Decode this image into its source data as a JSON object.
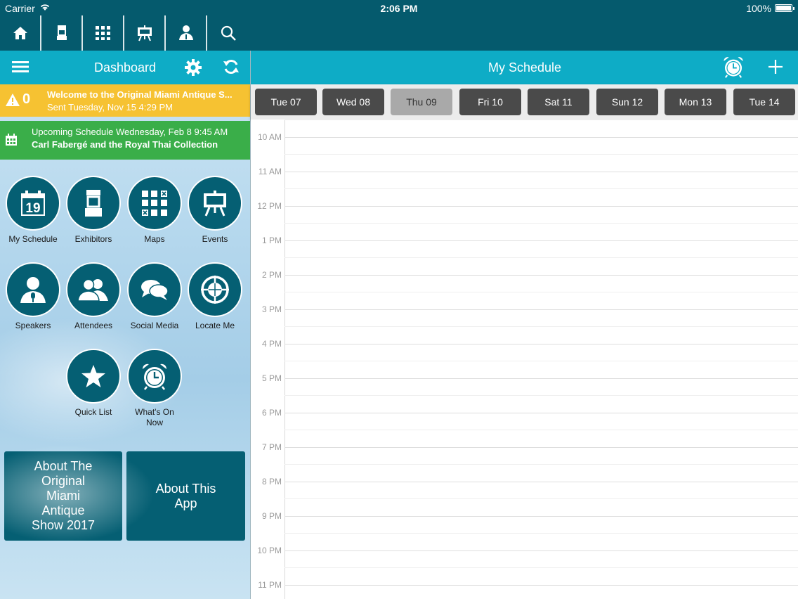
{
  "status": {
    "carrier": "Carrier",
    "time": "2:06 PM",
    "battery": "100%"
  },
  "topnav": {
    "icons": [
      "home-icon",
      "exhibitor-booth-icon",
      "maps-grid-icon",
      "easel-icon",
      "speaker-icon",
      "search-icon"
    ]
  },
  "dashboard": {
    "title": "Dashboard"
  },
  "alert": {
    "count": "0",
    "title": "Welcome to the Original Miami Antique S...",
    "sent": "Sent Tuesday, Nov 15 4:29 PM"
  },
  "upcoming": {
    "line1": "Upcoming Schedule Wednesday, Feb 8 9:45 AM",
    "line2": "Carl Fabergé and the Royal Thai Collection"
  },
  "tiles": [
    {
      "label": "My Schedule",
      "icon": "calendar-icon",
      "day": "19"
    },
    {
      "label": "Exhibitors",
      "icon": "booth-icon"
    },
    {
      "label": "Maps",
      "icon": "maps-icon"
    },
    {
      "label": "Events",
      "icon": "easel-icon"
    },
    {
      "label": "Speakers",
      "icon": "speaker-icon"
    },
    {
      "label": "Attendees",
      "icon": "attendees-icon"
    },
    {
      "label": "Social Media",
      "icon": "chat-bubbles-icon"
    },
    {
      "label": "Locate Me",
      "icon": "crosshair-icon"
    },
    {
      "label": "Quick List",
      "icon": "star-icon"
    },
    {
      "label": "What's On Now",
      "icon": "alarm-clock-icon"
    }
  ],
  "about": {
    "show": "About The Original Miami Antique Show 2017",
    "app": "About This App"
  },
  "schedule": {
    "title": "My Schedule",
    "days": [
      "Tue 07",
      "Wed 08",
      "Thu 09",
      "Fri 10",
      "Sat 11",
      "Sun 12",
      "Mon 13",
      "Tue 14"
    ],
    "selected_day": "Thu 09",
    "hours": [
      "10 AM",
      "11 AM",
      "12 PM",
      "1 PM",
      "2 PM",
      "3 PM",
      "4 PM",
      "5 PM",
      "6 PM",
      "7 PM",
      "8 PM",
      "9 PM",
      "10 PM",
      "11 PM"
    ]
  },
  "colors": {
    "dark_teal": "#055a6d",
    "header_teal": "#0eacc6",
    "alert_yellow": "#f6c232",
    "upcoming_green": "#3aae49",
    "tile": "#055f73"
  }
}
